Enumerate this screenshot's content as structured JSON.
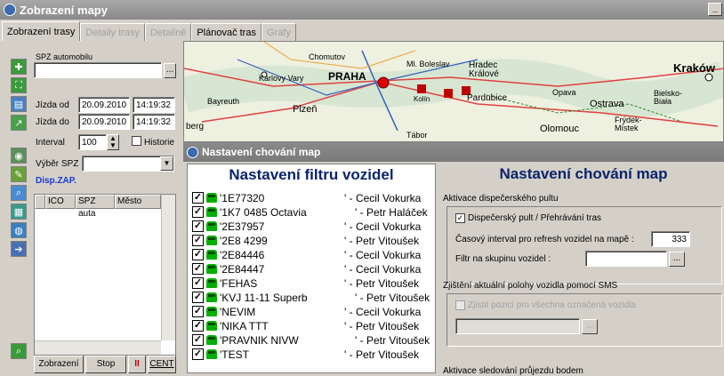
{
  "window": {
    "title": "Zobrazení mapy",
    "min_label": "_"
  },
  "tabs": [
    {
      "label": "Zobrazení trasy",
      "state": "active"
    },
    {
      "label": "Detaily trasy",
      "state": "disabled"
    },
    {
      "label": "Detailně",
      "state": "disabled"
    },
    {
      "label": "Plánovač tras",
      "state": "normal"
    },
    {
      "label": "Grafy",
      "state": "disabled"
    }
  ],
  "left": {
    "spz_label": "SPZ automobilu",
    "spz_value": "",
    "browse_label": "...",
    "from_label": "Jízda od",
    "from_date": "20.09.2010",
    "from_time": "14:19:32",
    "to_label": "Jízda do",
    "to_date": "20.09.2010",
    "to_time": "14:19:32",
    "interval_label": "Interval",
    "interval_value": "100",
    "history_label": "Historie",
    "select_spz_label": "Výběr SPZ",
    "disp_label": "Disp.ZAP.",
    "grid_columns": [
      "ICO",
      "SPZ auta",
      "Město"
    ],
    "buttons": {
      "show": "Zobrazení",
      "stop": "Stop",
      "pause": "II",
      "center": "CENT"
    }
  },
  "map": {
    "cities": [
      "Chomutov",
      "Ml. Boleslav",
      "Hradec Králové",
      "Kraków",
      "Karlovy Vary",
      "PRAHA",
      "Kolín",
      "Pardubice",
      "Opava",
      "Bielsko-Biała",
      "Bayreuth",
      "Plzeň",
      "Ostrava",
      "Olomouc",
      "Frýdek-Místek",
      "Tábor",
      "berg"
    ]
  },
  "settings": {
    "title": "Nastavení chování map",
    "filter_heading": "Nastavení filtru vozidel",
    "vehicles": [
      {
        "spz": "'1E77320",
        "driver": "' - Cecil Vokurka"
      },
      {
        "spz": "'1K7 0485  Octavia",
        "driver": "' - Petr Haláček"
      },
      {
        "spz": "'2E37957",
        "driver": "' - Cecil Vokurka"
      },
      {
        "spz": "'2E8 4299",
        "driver": "' - Petr Vitoušek"
      },
      {
        "spz": "'2E84446",
        "driver": "' - Cecil Vokurka"
      },
      {
        "spz": "'2E84447",
        "driver": "' - Cecil Vokurka"
      },
      {
        "spz": "'FEHAS",
        "driver": "' - Petr Vitoušek"
      },
      {
        "spz": "'KVJ 11-11 Superb",
        "driver": "' - Petr Vitoušek"
      },
      {
        "spz": "'NEVIM",
        "driver": "' - Cecil Vokurka"
      },
      {
        "spz": "'NIKA TTT",
        "driver": "' - Petr Vitoušek"
      },
      {
        "spz": "'PRAVNIK NIVW",
        "driver": "' - Petr Vitoušek"
      },
      {
        "spz": "'TEST",
        "driver": "' - Petr Vitoušek"
      }
    ],
    "map_heading": "Nastavení chování map",
    "dispatch_section": "Aktivace dispečerského pultu",
    "dispatch_checkbox": "Dispečerský pult / Přehrávání tras",
    "refresh_label": "Časový interval pro refresh vozidel na mapě :",
    "refresh_value": "333",
    "group_filter_label": "Filtr na skupinu vozidel :",
    "group_filter_value": "",
    "browse_label": "...",
    "sms_section": "Zjištění aktuální polohy vozidla pomocí SMS",
    "sms_checkbox": "Zjistit pozici pro všechna označená vozidla",
    "next_section": "Aktivace sledování průjezdu bodem"
  }
}
